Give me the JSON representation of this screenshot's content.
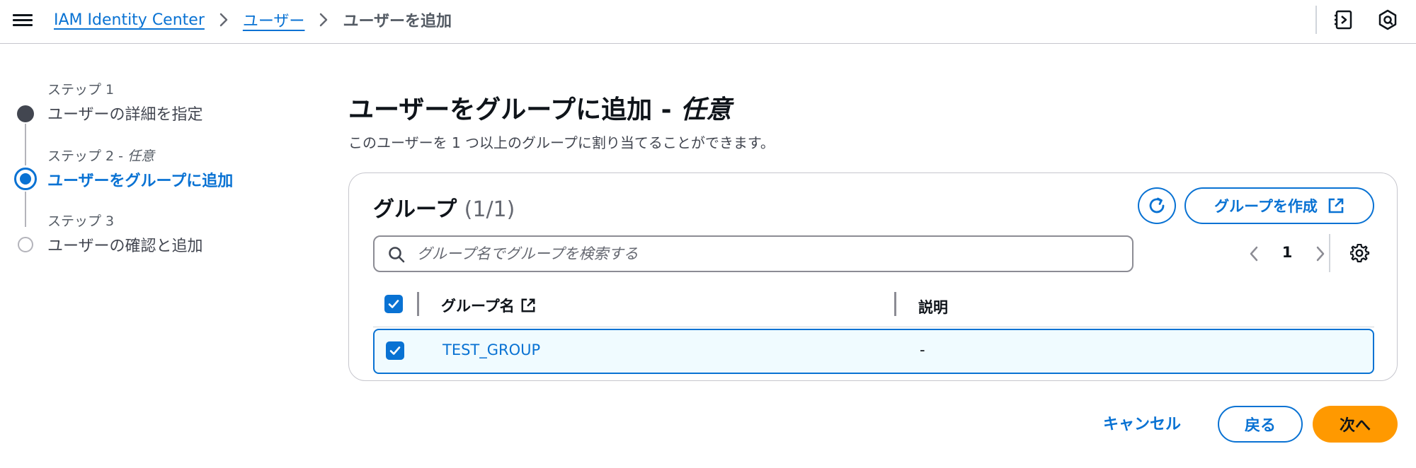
{
  "breadcrumbs": {
    "items": [
      "IAM Identity Center",
      "ユーザー"
    ],
    "current": "ユーザーを追加"
  },
  "topbar_icons": [
    "tools-panel-icon",
    "notifications-icon"
  ],
  "steps": [
    {
      "number": "ステップ 1",
      "title": "ユーザーの詳細を指定",
      "state": "completed"
    },
    {
      "number": "ステップ 2 -",
      "optional": "任意",
      "title": "ユーザーをグループに追加",
      "state": "active"
    },
    {
      "number": "ステップ 3",
      "title": "ユーザーの確認と追加",
      "state": "pending"
    }
  ],
  "main": {
    "title": "ユーザーをグループに追加 -",
    "title_optional": "任意",
    "description": "このユーザーを 1 つ以上のグループに割り当てることができます。"
  },
  "groups_panel": {
    "title": "グループ",
    "count": "(1/1)",
    "create_button": "グループを作成",
    "search_placeholder": "グループ名でグループを検索する",
    "search_value": "",
    "page": "1",
    "columns": [
      "グループ名",
      "説明"
    ],
    "select_all_checked": true,
    "rows": [
      {
        "name": "TEST_GROUP",
        "description": "-",
        "selected": true
      }
    ]
  },
  "footer": {
    "cancel": "キャンセル",
    "back": "戻る",
    "next": "次へ"
  },
  "colors": {
    "accent": "#0972d3",
    "primary_button": "#ff9900",
    "text": "#0f141a",
    "row_selected_bg": "#f0fbff"
  }
}
